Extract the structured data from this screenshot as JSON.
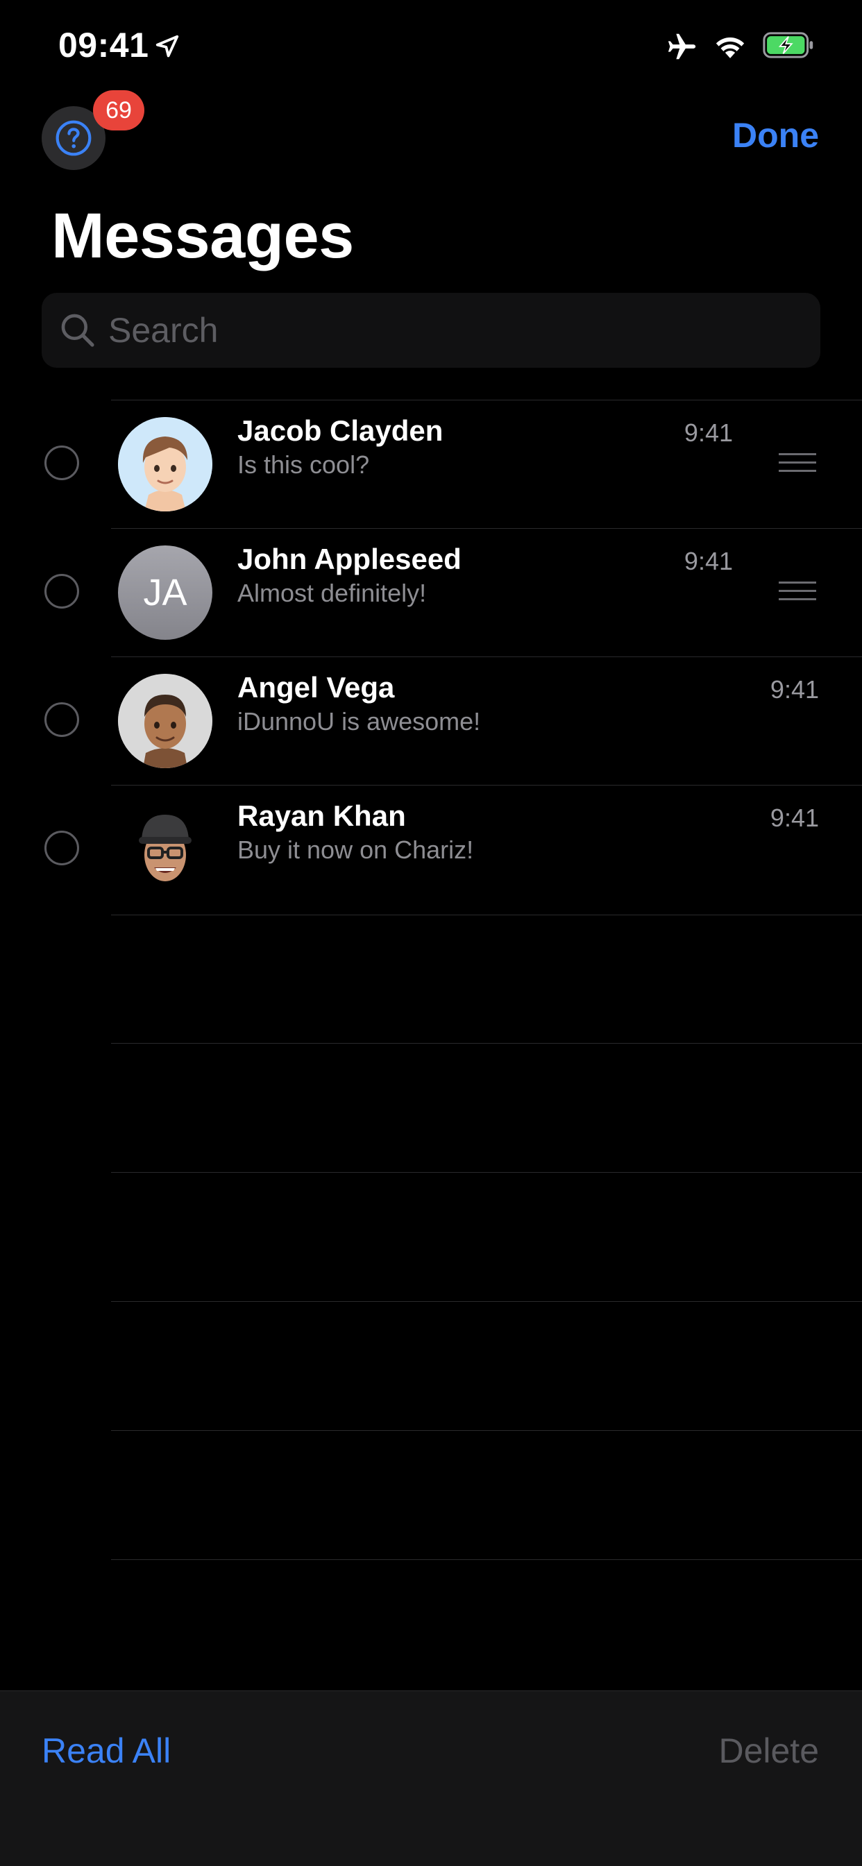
{
  "status": {
    "time": "09:41"
  },
  "header": {
    "badge_count": "69",
    "done_label": "Done",
    "title": "Messages"
  },
  "search": {
    "placeholder": "Search",
    "value": ""
  },
  "conversations": [
    {
      "name": "Jacob Clayden",
      "preview": "Is this cool?",
      "time": "9:41",
      "avatar": "memoji-jacob",
      "pinned_handle": true
    },
    {
      "name": "John Appleseed",
      "preview": "Almost definitely!",
      "time": "9:41",
      "avatar_initials": "JA",
      "pinned_handle": true
    },
    {
      "name": "Angel Vega",
      "preview": "iDunnoU is awesome!",
      "time": "9:41",
      "avatar": "memoji-angel",
      "pinned_handle": false
    },
    {
      "name": "Rayan Khan",
      "preview": "Buy it now on Chariz!",
      "time": "9:41",
      "avatar": "memoji-rayan",
      "pinned_handle": false
    }
  ],
  "toolbar": {
    "read_all_label": "Read All",
    "delete_label": "Delete"
  },
  "colors": {
    "accent": "#3b82f6",
    "badge": "#e8443a",
    "battery": "#4cd964"
  }
}
